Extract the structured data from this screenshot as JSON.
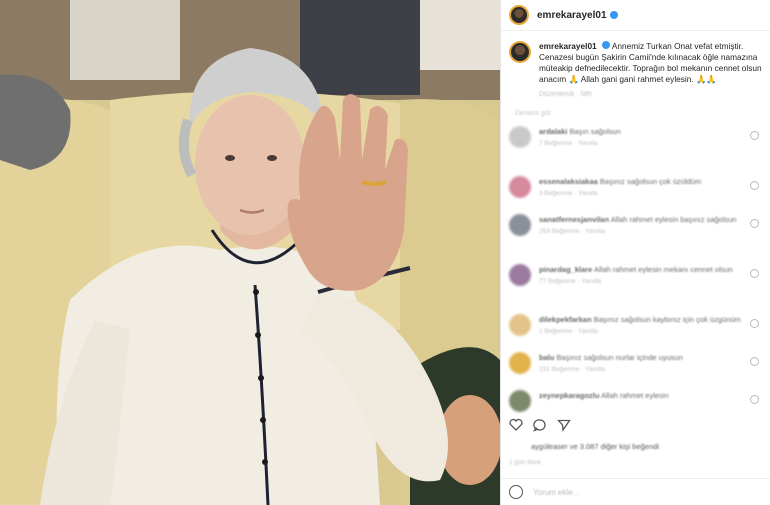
{
  "post": {
    "username": "emrekarayel01",
    "caption_user": "emrekarayel01",
    "caption_text": "Annemiz Turkan Onat vefat etmiştir. Cenazesi bugün Şakirin Camii'nde kılınacak öğle namazına müteakip defnedilecektir. Toprağın bol mekanın cennet olsun anacım 🙏 Allah gani gani rahmet eylesin. 🙏🙏",
    "caption_meta": "Düzenlendi · 58h",
    "more_comments": "Devamı gör"
  },
  "comments": [
    {
      "user": "ardalaki",
      "text": "Başın sağolsun",
      "sub": "7 Beğenme · Yanıtla",
      "color": "#c9c9c9"
    },
    {
      "user": "essenalaksiakaa",
      "text": "Başınız sağolsun çok üzüldüm",
      "sub": "3 Beğenme · Yanıtla",
      "color": "#d68a9e"
    },
    {
      "user": "sanatfernesjanvilan",
      "text": "Allah rahmet eylesin başınız sağolsun",
      "sub": "253 Beğenme · Yanıtla",
      "color": "#8a8f9a"
    },
    {
      "user": "pinardag_klare",
      "text": "Allah rahmet eylesin mekanı cennet olsun",
      "sub": "77 Beğenme · Yanıtla",
      "color": "#9c7aa0"
    },
    {
      "user": "dilekpekfarkan",
      "text": "Başınız sağolsun kaybınız için çok üzgünüm",
      "sub": "1 Beğenme · Yanıtla",
      "color": "#e3c38a"
    },
    {
      "user": "balu",
      "text": "Başınız sağolsun nurlar içinde uyusun",
      "sub": "151 Beğenme · Yanıtla",
      "color": "#e2b24a"
    },
    {
      "user": "zeynepkaragozlu",
      "text": "Allah rahmet eylesin",
      "sub": "",
      "color": "#7d8a6b"
    }
  ],
  "likes_text": "aygüleaser ve 3.087 diğer kişi beğendi",
  "date_text": "1 gün önce",
  "add_comment_placeholder": "Yorum ekle..."
}
